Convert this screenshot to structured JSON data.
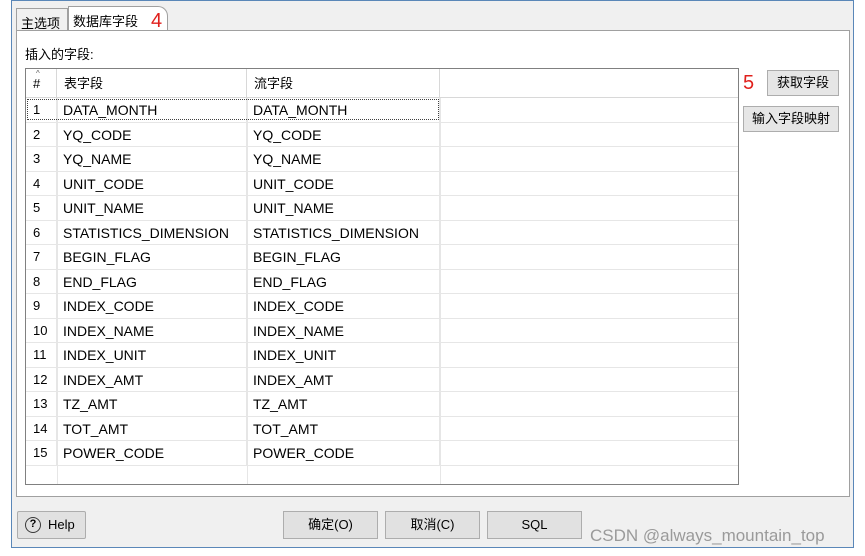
{
  "tabs": [
    {
      "label": "主选项",
      "active": false
    },
    {
      "label": "数据库字段",
      "active": true
    }
  ],
  "annotations": {
    "tab_marker": "4",
    "button_marker": "5",
    "marker_color": "#e0201c"
  },
  "panel": {
    "label": "插入的字段:"
  },
  "grid": {
    "headers": {
      "num": "#",
      "table_field": "表字段",
      "stream_field": "流字段"
    },
    "rows": [
      {
        "num": "1",
        "table_field": "DATA_MONTH",
        "stream_field": "DATA_MONTH"
      },
      {
        "num": "2",
        "table_field": "YQ_CODE",
        "stream_field": "YQ_CODE"
      },
      {
        "num": "3",
        "table_field": "YQ_NAME",
        "stream_field": "YQ_NAME"
      },
      {
        "num": "4",
        "table_field": "UNIT_CODE",
        "stream_field": "UNIT_CODE"
      },
      {
        "num": "5",
        "table_field": "UNIT_NAME",
        "stream_field": "UNIT_NAME"
      },
      {
        "num": "6",
        "table_field": "STATISTICS_DIMENSION",
        "stream_field": "STATISTICS_DIMENSION"
      },
      {
        "num": "7",
        "table_field": "BEGIN_FLAG",
        "stream_field": "BEGIN_FLAG"
      },
      {
        "num": "8",
        "table_field": "END_FLAG",
        "stream_field": "END_FLAG"
      },
      {
        "num": "9",
        "table_field": "INDEX_CODE",
        "stream_field": "INDEX_CODE"
      },
      {
        "num": "10",
        "table_field": "INDEX_NAME",
        "stream_field": "INDEX_NAME"
      },
      {
        "num": "11",
        "table_field": "INDEX_UNIT",
        "stream_field": "INDEX_UNIT"
      },
      {
        "num": "12",
        "table_field": "INDEX_AMT",
        "stream_field": "INDEX_AMT"
      },
      {
        "num": "13",
        "table_field": "TZ_AMT",
        "stream_field": "TZ_AMT"
      },
      {
        "num": "14",
        "table_field": "TOT_AMT",
        "stream_field": "TOT_AMT"
      },
      {
        "num": "15",
        "table_field": "POWER_CODE",
        "stream_field": "POWER_CODE"
      }
    ]
  },
  "side_buttons": {
    "get_fields": "获取字段",
    "input_mapping": "输入字段映射"
  },
  "footer": {
    "help": "Help",
    "ok": "确定(O)",
    "cancel": "取消(C)",
    "sql": "SQL"
  },
  "watermark": "CSDN @always_mountain_top"
}
